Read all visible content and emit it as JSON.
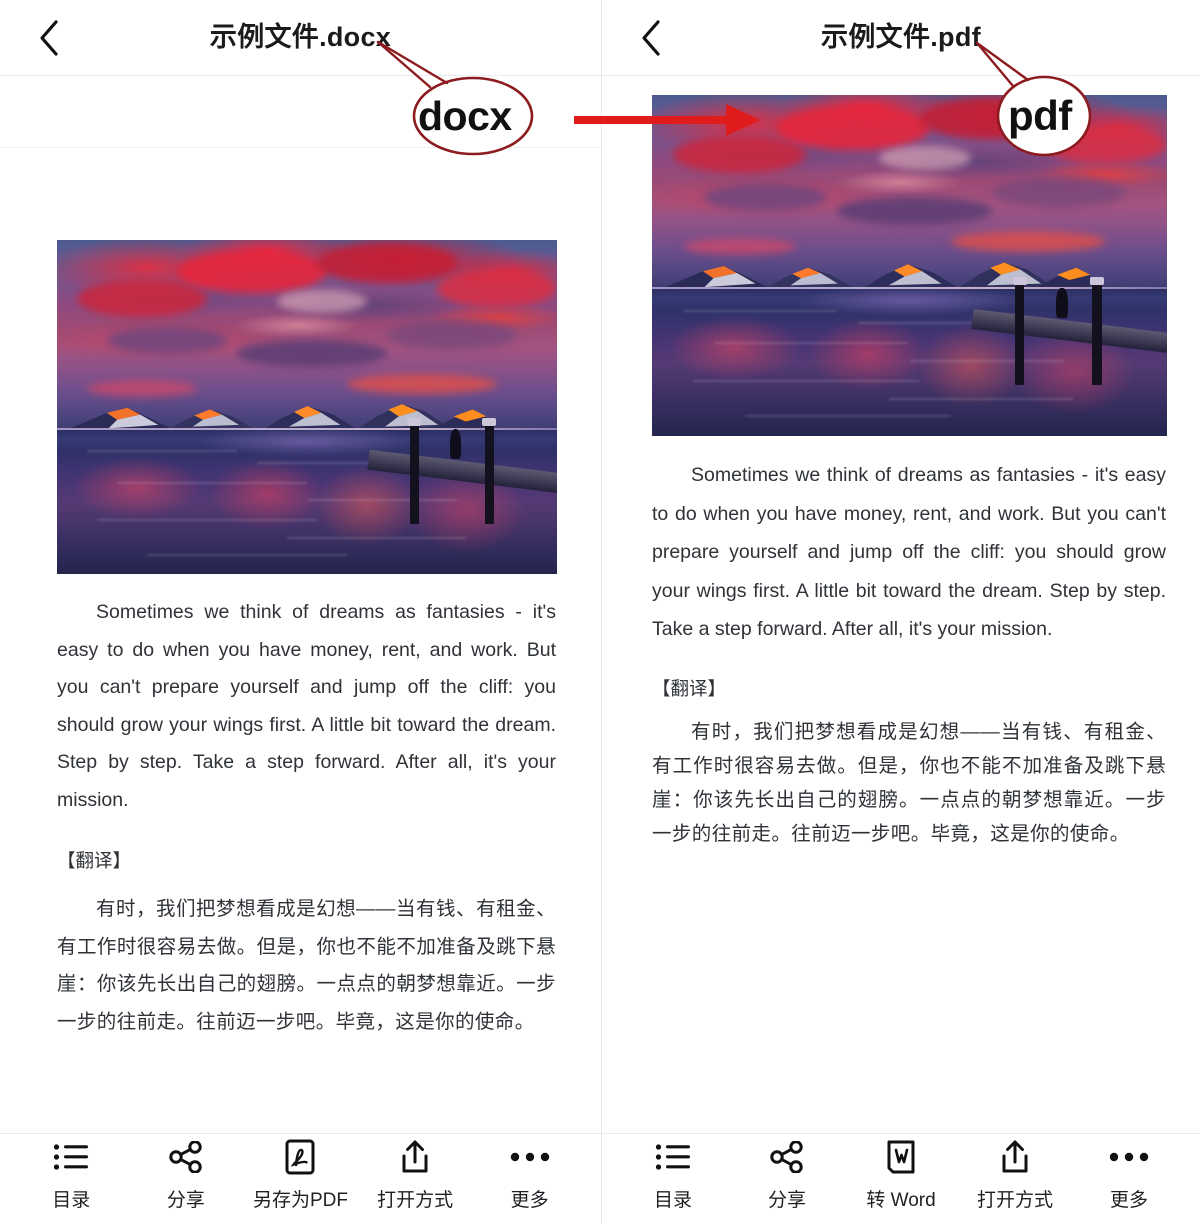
{
  "meta": {
    "accent_red": "#e01b1b",
    "callout_outline": "#8c1a1e",
    "text_color": "#2f3338",
    "title_color": "#1b1b1b"
  },
  "annotations": {
    "docx_bubble": "docx",
    "pdf_bubble": "pdf",
    "arrow": "conversion-arrow"
  },
  "panels": [
    {
      "id": "docx",
      "header": {
        "back_icon": "chevron-left-icon",
        "title": "示例文件.docx"
      },
      "document": {
        "photo_alt": "sunset-lake-mountains-dock-photo",
        "paragraph_en": "Sometimes we think of dreams as fantasies - it's easy to do when you have money, rent, and work. But you can't prepare yourself and jump off the cliff: you should grow your wings first. A little bit toward the dream. Step by step. Take a step forward. After all, it's your mission.",
        "translation_tag": "【翻译】",
        "paragraph_cn": "有时，我们把梦想看成是幻想——当有钱、有租金、有工作时很容易去做。但是，你也不能不加准备及跳下悬崖：你该先长出自己的翅膀。一点点的朝梦想靠近。一步一步的往前走。往前迈一步吧。毕竟，这是你的使命。"
      },
      "toolbar": [
        {
          "icon": "list-icon",
          "label": "目录"
        },
        {
          "icon": "share-icon",
          "label": "分享"
        },
        {
          "icon": "pdf-file-icon",
          "label": "另存为PDF"
        },
        {
          "icon": "open-with-icon",
          "label": "打开方式"
        },
        {
          "icon": "more-icon",
          "label": "更多"
        }
      ]
    },
    {
      "id": "pdf",
      "header": {
        "back_icon": "chevron-left-icon",
        "title": "示例文件.pdf"
      },
      "document": {
        "photo_alt": "sunset-lake-mountains-dock-photo",
        "paragraph_en": "Sometimes we think of dreams as fantasies - it's easy to do when you have money, rent, and work. But you can't prepare yourself and jump off the cliff: you should grow your wings first. A little bit toward the dream. Step by step. Take a step forward. After all, it's your mission.",
        "translation_tag": "【翻译】",
        "paragraph_cn": "有时，我们把梦想看成是幻想——当有钱、有租金、有工作时很容易去做。但是，你也不能不加准备及跳下悬崖：你该先长出自己的翅膀。一点点的朝梦想靠近。一步一步的往前走。往前迈一步吧。毕竟，这是你的使命。"
      },
      "toolbar": [
        {
          "icon": "list-icon",
          "label": "目录"
        },
        {
          "icon": "share-icon",
          "label": "分享"
        },
        {
          "icon": "word-file-icon",
          "label": "转 Word"
        },
        {
          "icon": "open-with-icon",
          "label": "打开方式"
        },
        {
          "icon": "more-icon",
          "label": "更多"
        }
      ]
    }
  ]
}
